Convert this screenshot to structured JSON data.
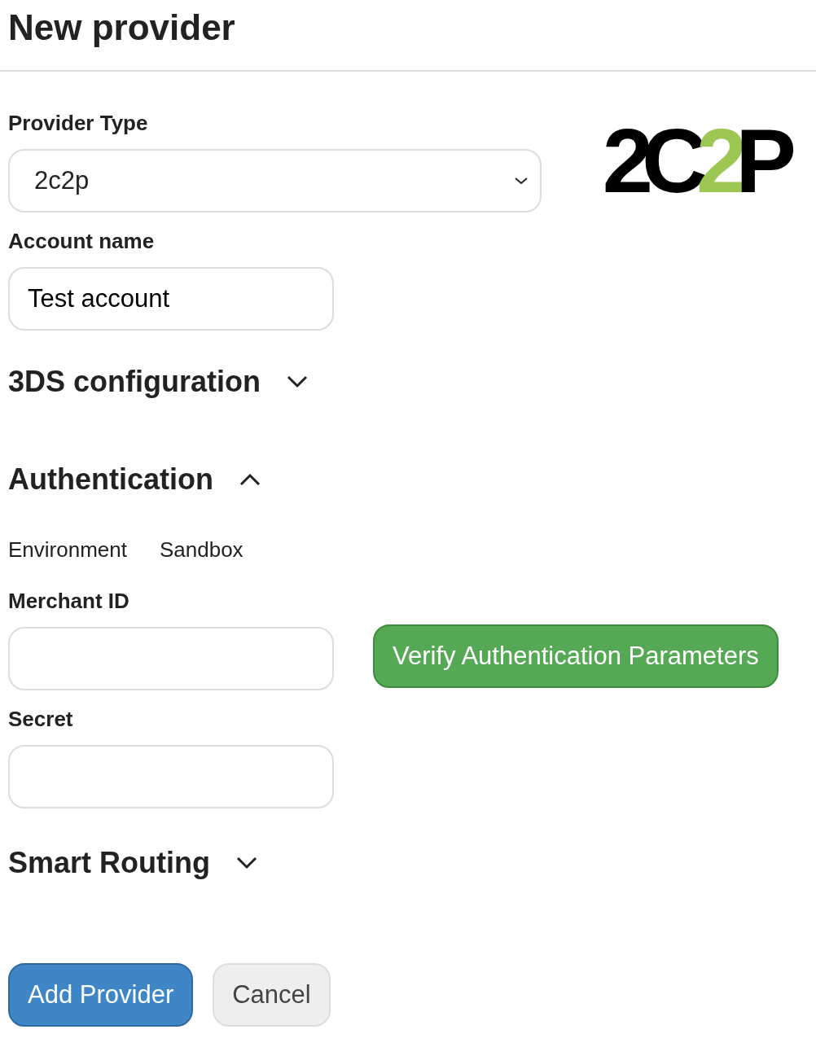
{
  "title": "New provider",
  "provider_type": {
    "label": "Provider Type",
    "value": "2c2p"
  },
  "logo": {
    "segments": [
      {
        "text": "2C",
        "accent": false
      },
      {
        "text": "2",
        "accent": true
      },
      {
        "text": "P",
        "accent": false
      }
    ]
  },
  "account_name": {
    "label": "Account name",
    "value": "Test account"
  },
  "sections": [
    {
      "title": "3DS configuration",
      "expanded": false
    },
    {
      "title": "Authentication",
      "expanded": true,
      "environment": {
        "label": "Environment",
        "value": "Sandbox"
      },
      "fields": [
        {
          "label": "Merchant ID"
        },
        {
          "label": "Secret"
        }
      ],
      "verify_button": "Verify Authentication Parameters"
    },
    {
      "title": "Smart Routing",
      "expanded": false
    }
  ],
  "buttons": [
    {
      "label": "Add Provider",
      "kind": "primary"
    },
    {
      "label": "Cancel",
      "kind": "secondary"
    }
  ]
}
